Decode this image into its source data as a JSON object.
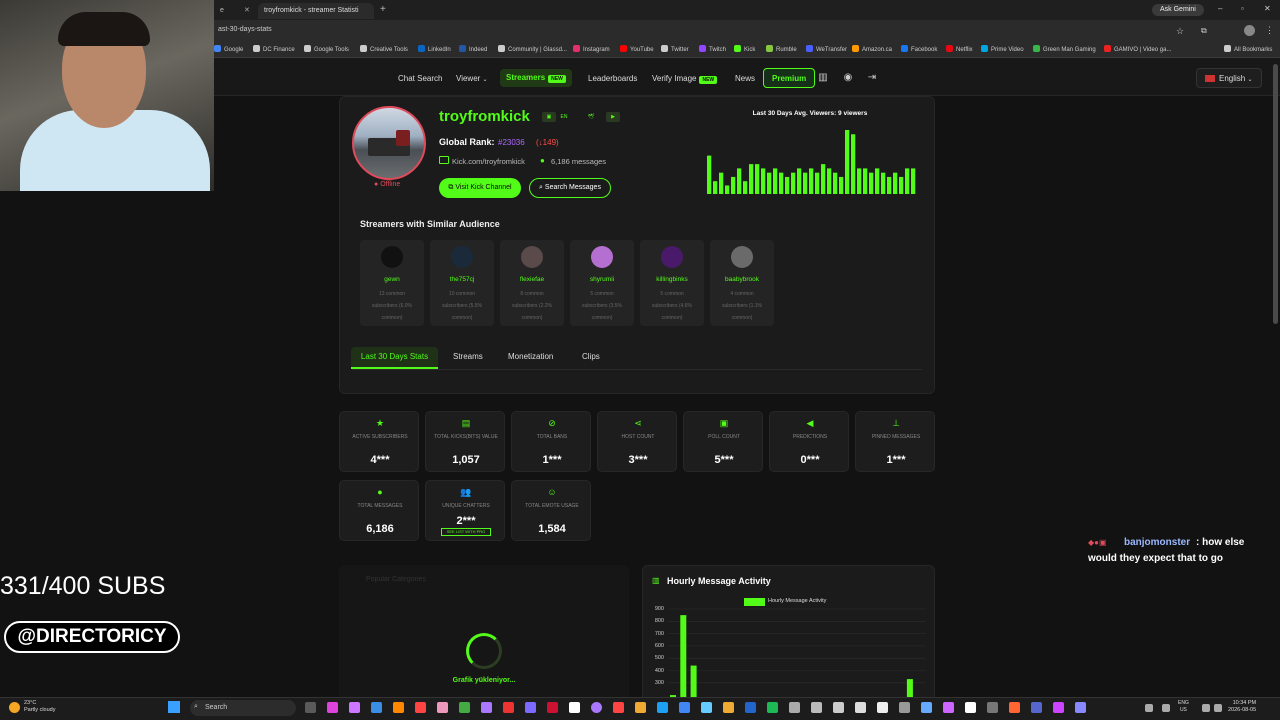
{
  "browser": {
    "tabs": [
      {
        "label": "e"
      },
      {
        "label": "troyfromkick - streamer Statisti"
      }
    ],
    "url": "ast-30-days-stats",
    "ask_gemini": "Ask Gemini",
    "bookmarks": [
      "Google",
      "DC Finance",
      "Google Tools",
      "Creative Tools",
      "LinkedIn",
      "Indeed",
      "Community | Glassd...",
      "Instagram",
      "YouTube",
      "Twitter",
      "Twitch",
      "Kick",
      "Rumble",
      "WeTransfer",
      "Amazon.ca",
      "Facebook",
      "Netflix",
      "Prime Video",
      "Green Man Gaming",
      "GAMIVO | Video ga...",
      "All Bookmarks"
    ]
  },
  "site_nav": {
    "items": [
      "Chat Search",
      "Viewer",
      "Streamers",
      "Leaderboards",
      "Verify Image",
      "News",
      "Premium"
    ],
    "new_badge": "NEW",
    "language": "English"
  },
  "profile": {
    "username": "troyfromkick",
    "status": "Offline",
    "rank_label": "Global Rank:",
    "rank_value": "#23036",
    "rank_change": "(↓149)",
    "channel_link": "Kick.com/troyfromkick",
    "messages": "6,186 messages",
    "visit_button": "Visit Kick Channel",
    "search_button": "Search Messages",
    "chip_en": "EN"
  },
  "viewers_chart": {
    "title": "Last 30 Days Avg. Viewers: 9 viewers",
    "values": [
      9,
      3,
      5,
      2,
      4,
      6,
      3,
      7,
      7,
      6,
      5,
      6,
      5,
      4,
      5,
      6,
      5,
      6,
      5,
      7,
      6,
      5,
      4,
      15,
      14,
      6,
      6,
      5,
      6,
      5,
      4,
      5,
      4,
      6,
      6
    ]
  },
  "similar": {
    "title": "Streamers with Similar Audience",
    "streamers": [
      {
        "name": "gewn",
        "common": "13 common",
        "subs": "subscribers (6.0%",
        "pct": "common)"
      },
      {
        "name": "the757cj",
        "common": "10 common",
        "subs": "subscribers (5.5%",
        "pct": "common)"
      },
      {
        "name": "flexiefae",
        "common": "8 common",
        "subs": "subscribers (2.2%",
        "pct": "common)"
      },
      {
        "name": "shyrumii",
        "common": "5 common",
        "subs": "subscribers (3.5%",
        "pct": "common)"
      },
      {
        "name": "killingbinks",
        "common": "5 common",
        "subs": "subscribers (4.6%",
        "pct": "common)"
      },
      {
        "name": "baabybrook",
        "common": "4 common",
        "subs": "subscribers (1.1%",
        "pct": "common)"
      }
    ]
  },
  "profile_tabs": [
    "Last 30 Days Stats",
    "Streams",
    "Monetization",
    "Clips"
  ],
  "stats": [
    {
      "label": "ACTIVE SUBSCRIBERS",
      "value": "4***",
      "icon": "star-icon"
    },
    {
      "label": "TOTAL KICKS(BITS) VALUE",
      "value": "1,057",
      "icon": "coins-icon"
    },
    {
      "label": "TOTAL BANS",
      "value": "1***",
      "icon": "ban-icon"
    },
    {
      "label": "HOST COUNT",
      "value": "3***",
      "icon": "share-icon"
    },
    {
      "label": "POLL COUNT",
      "value": "5***",
      "icon": "poll-icon"
    },
    {
      "label": "PREDICTIONS",
      "value": "0***",
      "icon": "megaphone-icon"
    },
    {
      "label": "PINNED MESSAGES",
      "value": "1***",
      "icon": "pin-icon"
    },
    {
      "label": "TOTAL MESSAGES",
      "value": "6,186",
      "icon": "chat-icon"
    },
    {
      "label": "UNIQUE CHATTERS",
      "value": "2***",
      "icon": "users-icon",
      "badge": "SEE LIST WITH PRO"
    },
    {
      "label": "TOTAL EMOTE USAGE",
      "value": "1,584",
      "icon": "smile-icon"
    }
  ],
  "categories_panel": {
    "title": "Popular Categories",
    "loading": "Grafik yükleniyor..."
  },
  "chart_data": {
    "type": "bar",
    "title": "Hourly Message Activity",
    "series": [
      {
        "name": "Hourly Message Activity",
        "values": [
          200,
          850,
          440,
          0,
          0,
          0,
          0,
          0,
          0,
          0,
          0,
          0,
          0,
          0,
          0,
          0,
          0,
          0,
          0,
          0,
          0,
          0,
          0,
          330
        ]
      }
    ],
    "y_ticks": [
      "900",
      "800",
      "700",
      "600",
      "500",
      "400",
      "300"
    ],
    "ylim": [
      300,
      900
    ],
    "colors": {
      "bar": "#53fc18"
    }
  },
  "overlay": {
    "subs": "331/400 SUBS",
    "handle": "@DIRECTORICY",
    "chat_user": "banjomonster",
    "chat_line1": ": how else",
    "chat_line2": "would they expect that to go"
  },
  "taskbar": {
    "weather_temp": "23°C",
    "weather_desc": "Partly cloudy",
    "search": "Search",
    "lang1": "ENG",
    "lang2": "US",
    "time": "10:34 PM",
    "date": "2026-08-05"
  },
  "colors": {
    "accent": "#53fc18",
    "rank": "#b069ff",
    "offline": "#e04a5a"
  }
}
